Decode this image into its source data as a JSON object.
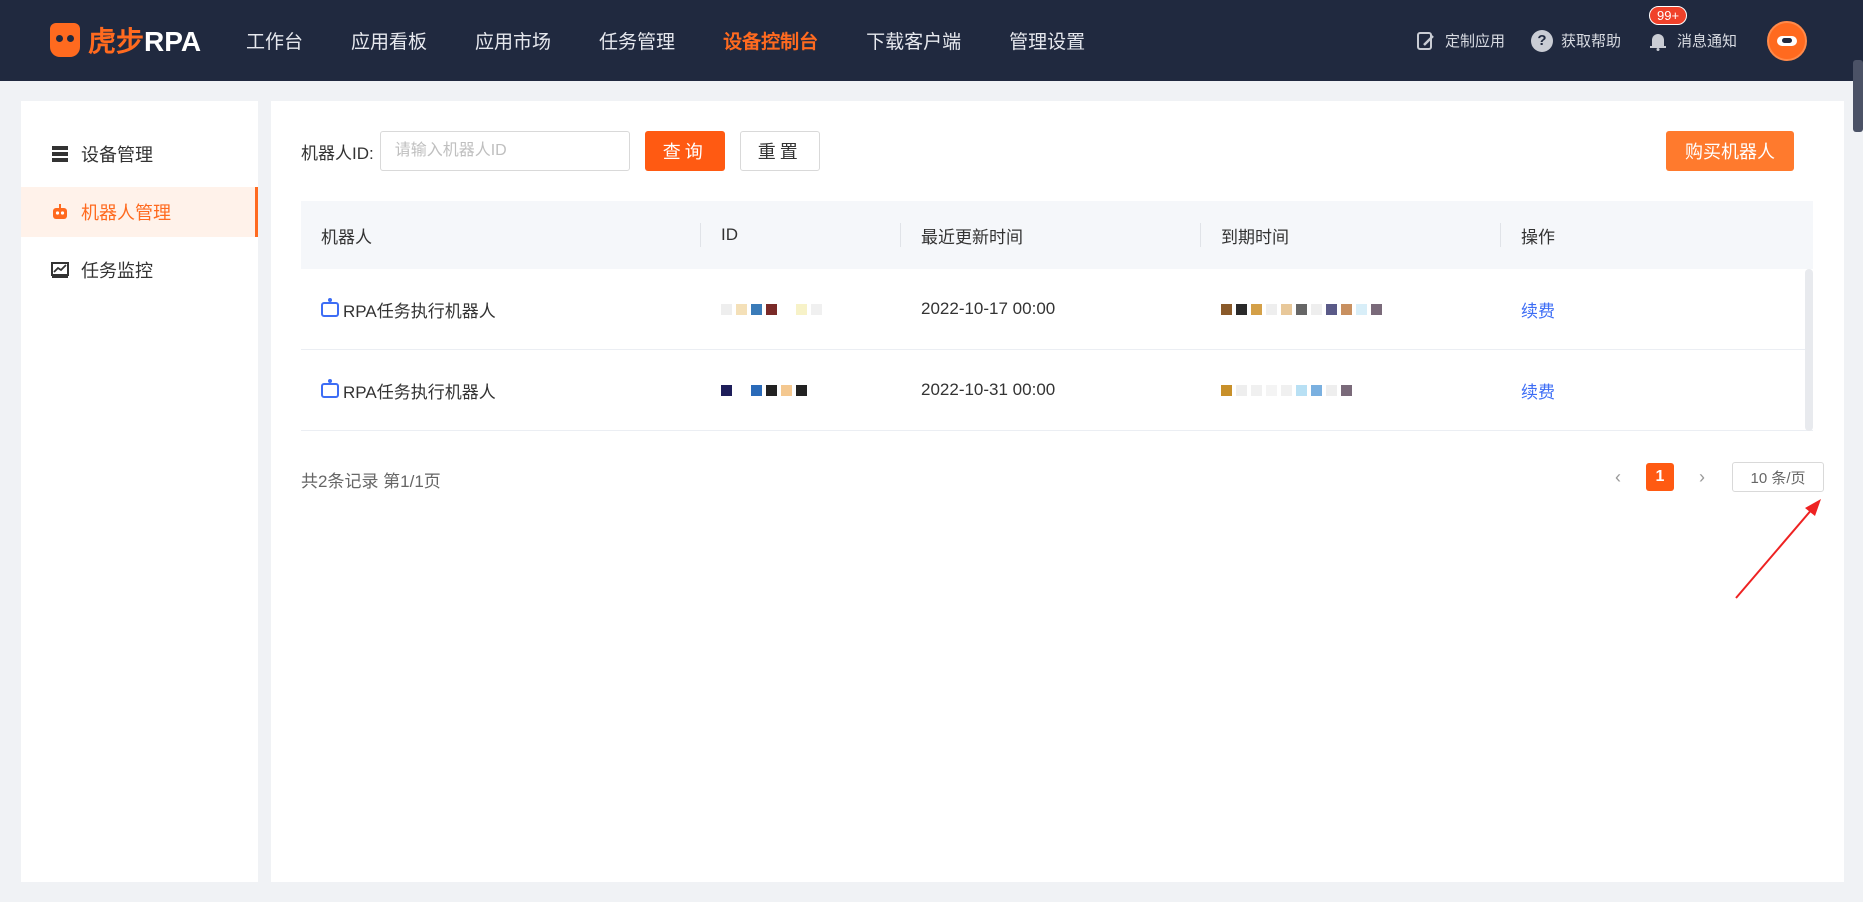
{
  "header": {
    "logo_text_a": "虎步",
    "logo_text_b": "RPA",
    "nav": [
      {
        "label": "工作台"
      },
      {
        "label": "应用看板"
      },
      {
        "label": "应用市场"
      },
      {
        "label": "任务管理"
      },
      {
        "label": "设备控制台",
        "active": true
      },
      {
        "label": "下载客户端"
      },
      {
        "label": "管理设置"
      }
    ],
    "right": {
      "custom_app": "定制应用",
      "help": "获取帮助",
      "help_glyph": "?",
      "notify": "消息通知",
      "badge": "99+"
    },
    "colors": {
      "bar": "#20293f",
      "accent": "#ff6a1f"
    }
  },
  "sidebar": {
    "items": [
      {
        "label": "设备管理",
        "icon": "server-icon"
      },
      {
        "label": "机器人管理",
        "icon": "robot-icon",
        "active": true
      },
      {
        "label": "任务监控",
        "icon": "chart-icon"
      }
    ]
  },
  "filter": {
    "label": "机器人ID:",
    "placeholder": "请输入机器人ID",
    "query": "查询",
    "reset": "重置",
    "buy": "购买机器人"
  },
  "table": {
    "headers": [
      "机器人",
      "ID",
      "最近更新时间",
      "到期时间",
      "操作"
    ],
    "rows": [
      {
        "name": "RPA任务执行机器人",
        "updated": "2022-10-17 00:00",
        "action": "续费"
      },
      {
        "name": "RPA任务执行机器人",
        "updated": "2022-10-31 00:00",
        "action": "续费"
      }
    ]
  },
  "pagination": {
    "summary": "共2条记录 第1/1页",
    "current": "1",
    "prev": "‹",
    "next": "›",
    "page_size": "10 条/页"
  }
}
